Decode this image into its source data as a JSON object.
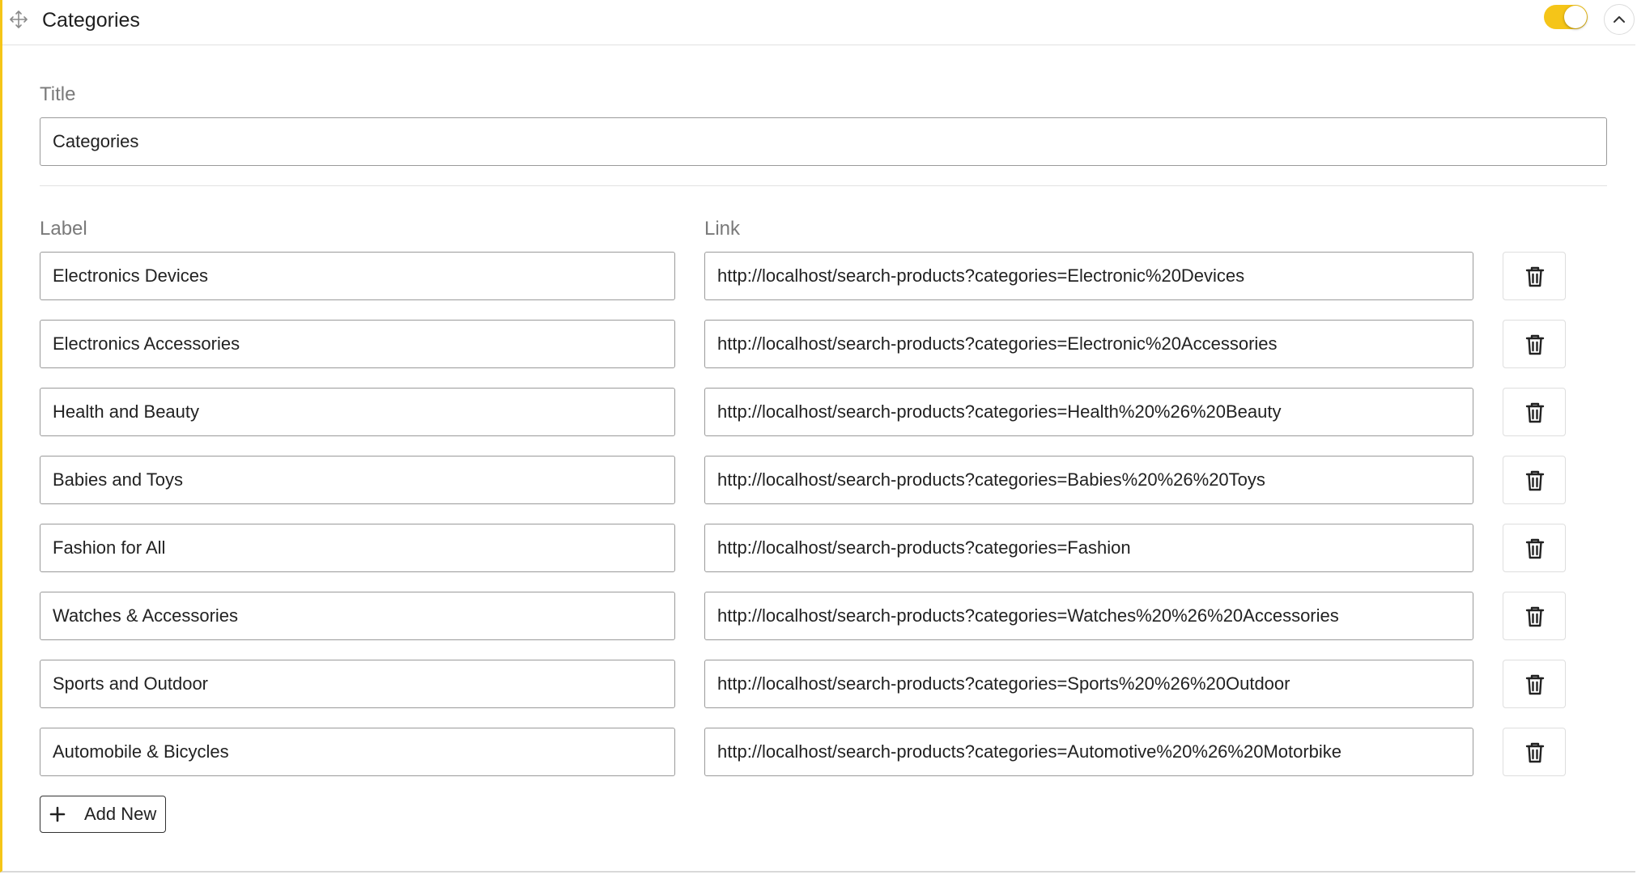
{
  "panel": {
    "title": "Categories",
    "icons": {
      "drag": "move-arrows-icon",
      "collapse": "chevron-up-icon"
    },
    "enabled": true,
    "accent_color": "#f5c518"
  },
  "form": {
    "title_label": "Title",
    "title_value": "Categories",
    "label_header": "Label",
    "link_header": "Link",
    "rows": [
      {
        "label": "Electronics Devices",
        "link": "http://localhost/search-products?categories=Electronic%20Devices"
      },
      {
        "label": "Electronics Accessories",
        "link": "http://localhost/search-products?categories=Electronic%20Accessories"
      },
      {
        "label": "Health and Beauty",
        "link": "http://localhost/search-products?categories=Health%20%26%20Beauty"
      },
      {
        "label": "Babies and Toys",
        "link": "http://localhost/search-products?categories=Babies%20%26%20Toys"
      },
      {
        "label": "Fashion for All",
        "link": "http://localhost/search-products?categories=Fashion"
      },
      {
        "label": "Watches & Accessories",
        "link": "http://localhost/search-products?categories=Watches%20%26%20Accessories"
      },
      {
        "label": "Sports and Outdoor",
        "link": "http://localhost/search-products?categories=Sports%20%26%20Outdoor"
      },
      {
        "label": "Automobile & Bicycles",
        "link": "http://localhost/search-products?categories=Automotive%20%26%20Motorbike"
      }
    ],
    "delete_icon": "trash-icon",
    "add_new_label": "Add New",
    "add_icon": "plus-icon"
  }
}
